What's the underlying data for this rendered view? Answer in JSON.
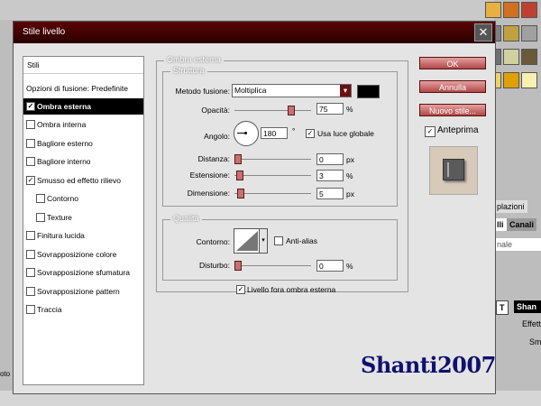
{
  "dialog": {
    "title": "Stile livello",
    "close_glyph": "✕"
  },
  "left_list": {
    "header": "Stili",
    "items": [
      {
        "label": "Opzioni di fusione: Predefinite",
        "checkbox": false,
        "checked": false,
        "selected": false
      },
      {
        "label": "Ombra esterna",
        "checkbox": true,
        "checked": true,
        "selected": true
      },
      {
        "label": "Ombra interna",
        "checkbox": true,
        "checked": false,
        "selected": false
      },
      {
        "label": "Bagliore esterno",
        "checkbox": true,
        "checked": false,
        "selected": false
      },
      {
        "label": "Bagliore interno",
        "checkbox": true,
        "checked": false,
        "selected": false
      },
      {
        "label": "Smusso ed effetto rilievo",
        "checkbox": true,
        "checked": true,
        "selected": false
      },
      {
        "label": "Contorno",
        "checkbox": true,
        "checked": false,
        "selected": false,
        "indent": true
      },
      {
        "label": "Texture",
        "checkbox": true,
        "checked": false,
        "selected": false,
        "indent": true
      },
      {
        "label": "Finitura lucida",
        "checkbox": true,
        "checked": false,
        "selected": false
      },
      {
        "label": "Sovrapposizione colore",
        "checkbox": true,
        "checked": false,
        "selected": false
      },
      {
        "label": "Sovrapposizione sfumatura",
        "checkbox": true,
        "checked": false,
        "selected": false
      },
      {
        "label": "Sovrapposizione pattern",
        "checkbox": true,
        "checked": false,
        "selected": false
      },
      {
        "label": "Traccia",
        "checkbox": true,
        "checked": false,
        "selected": false
      }
    ]
  },
  "ombra": {
    "legend": "Ombra esterna",
    "struttura_legend": "Struttura",
    "blend_label": "Metodo fusione:",
    "blend_value": "Moltiplica",
    "color": "#000000",
    "opacity_label": "Opacità:",
    "opacity_value": "75",
    "opacity_pct": 75,
    "pct": "%",
    "angle_label": "Angolo:",
    "angle_value": "180",
    "degree": "°",
    "global_light_label": "Usa luce globale",
    "distance_label": "Distanza:",
    "distance_value": "0",
    "px": "px",
    "spread_label": "Estensione:",
    "spread_value": "3",
    "size_label": "Dimensione:",
    "size_value": "5"
  },
  "qualita": {
    "legend": "Qualità",
    "contour_label": "Contorno:",
    "antialias_label": "Anti-alias",
    "noise_label": "Disturbo:",
    "noise_value": "0",
    "knockout_label": "Livello fora ombra esterna"
  },
  "buttons": {
    "ok": "OK",
    "cancel": "Annulla",
    "new_style": "Nuovo stile...",
    "preview": "Anteprima"
  },
  "background": {
    "tab1": "plazioni",
    "tab2": "lli",
    "tab3": "Canali",
    "mode": "nale",
    "layer_t": "T",
    "layer_name": "Shan",
    "effects": "Effetti",
    "sub": "Sm",
    "left_text": "oto"
  },
  "watermark": "Shanti2007"
}
